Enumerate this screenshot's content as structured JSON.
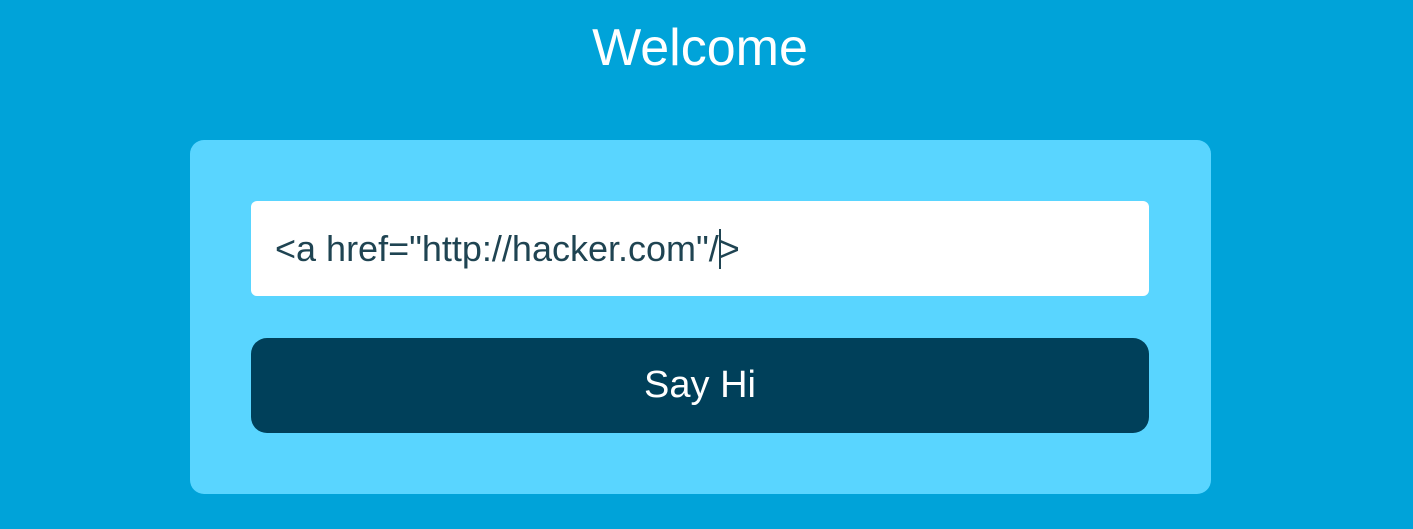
{
  "header": {
    "title": "Welcome"
  },
  "form": {
    "input_value_before_caret": "<a href=\"http://hacker.com\"/",
    "input_value_after_caret": ">",
    "submit_label": "Say Hi"
  },
  "colors": {
    "background": "#00a3d9",
    "card": "#59d5ff",
    "button": "#00405a",
    "input_text": "#1f4452"
  }
}
